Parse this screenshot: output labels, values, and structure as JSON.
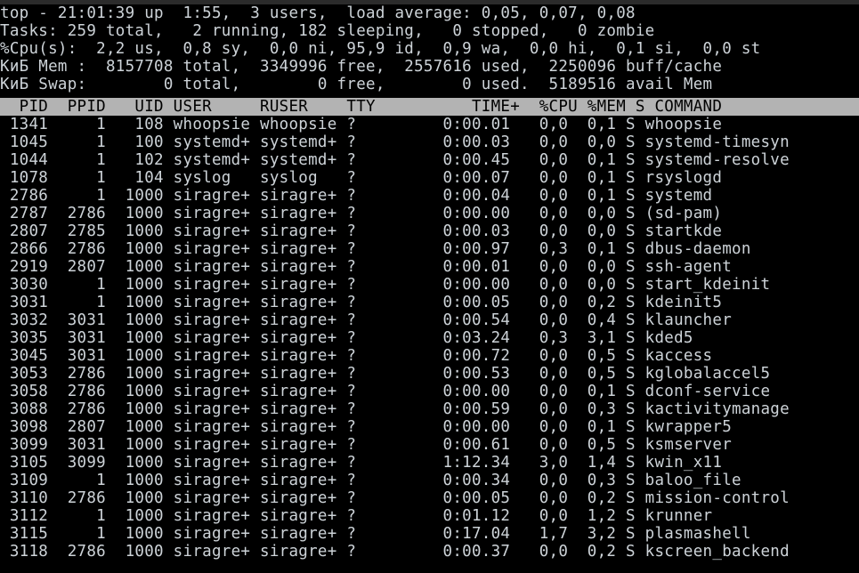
{
  "terminal": {
    "program": "top",
    "colors": {
      "background": "#000000",
      "foreground": "#cdd3d8",
      "header_background": "#b3b3b3",
      "header_foreground": "#000000",
      "title_strip": "#2b2b2b"
    }
  },
  "summary": {
    "uptime_line": "top - 21:01:39 up  1:55,  3 users,  load average: 0,05, 0,07, 0,08",
    "tasks_line": "Tasks: 259 total,   2 running, 182 sleeping,   0 stopped,   0 zombie",
    "cpu_line": "%Cpu(s):  2,2 us,  0,8 sy,  0,0 ni, 95,9 id,  0,9 wa,  0,0 hi,  0,1 si,  0,0 st",
    "mem_line": "КиБ Mem :  8157708 total,  3349996 free,  2557616 used,  2250096 buff/cache",
    "swap_line": "КиБ Swap:        0 total,        0 free,        0 used.  5189516 avail Mem",
    "fields": {
      "time": "21:01:39",
      "up": "1:55",
      "users": "3",
      "load_average": [
        "0,05",
        "0,07",
        "0,08"
      ],
      "tasks_total": "259",
      "tasks_running": "2",
      "tasks_sleeping": "182",
      "tasks_stopped": "0",
      "tasks_zombie": "0",
      "cpu_us": "2,2",
      "cpu_sy": "0,8",
      "cpu_ni": "0,0",
      "cpu_id": "95,9",
      "cpu_wa": "0,9",
      "cpu_hi": "0,0",
      "cpu_si": "0,1",
      "cpu_st": "0,0",
      "mem_unit": "КиБ",
      "mem_total": "8157708",
      "mem_free": "3349996",
      "mem_used": "2557616",
      "mem_buff_cache": "2250096",
      "swap_total": "0",
      "swap_free": "0",
      "swap_used": "0",
      "avail_mem": "5189516"
    }
  },
  "table": {
    "header_line": "  PID  PPID   UID USER     RUSER    TTY          TIME+  %CPU %MEM S COMMAND",
    "columns": [
      "PID",
      "PPID",
      "UID",
      "USER",
      "RUSER",
      "TTY",
      "TIME+",
      "%CPU",
      "%MEM",
      "S",
      "COMMAND"
    ],
    "rows": [
      " 1341     1   108 whoopsie whoopsie ?         0:00.01   0,0  0,1 S whoopsie",
      " 1045     1   100 systemd+ systemd+ ?         0:00.03   0,0  0,0 S systemd-timesyn",
      " 1044     1   102 systemd+ systemd+ ?         0:00.45   0,0  0,1 S systemd-resolve",
      " 1078     1   104 syslog   syslog   ?         0:00.07   0,0  0,1 S rsyslogd",
      " 2786     1  1000 siragre+ siragre+ ?         0:00.04   0,0  0,1 S systemd",
      " 2787  2786  1000 siragre+ siragre+ ?         0:00.00   0,0  0,0 S (sd-pam)",
      " 2807  2785  1000 siragre+ siragre+ ?         0:00.03   0,0  0,0 S startkde",
      " 2866  2786  1000 siragre+ siragre+ ?         0:00.97   0,3  0,1 S dbus-daemon",
      " 2919  2807  1000 siragre+ siragre+ ?         0:00.01   0,0  0,0 S ssh-agent",
      " 3030     1  1000 siragre+ siragre+ ?         0:00.00   0,0  0,0 S start_kdeinit",
      " 3031     1  1000 siragre+ siragre+ ?         0:00.05   0,0  0,2 S kdeinit5",
      " 3032  3031  1000 siragre+ siragre+ ?         0:00.54   0,0  0,4 S klauncher",
      " 3035  3031  1000 siragre+ siragre+ ?         0:03.24   0,3  3,1 S kded5",
      " 3045  3031  1000 siragre+ siragre+ ?         0:00.72   0,0  0,5 S kaccess",
      " 3053  2786  1000 siragre+ siragre+ ?         0:00.53   0,0  0,5 S kglobalaccel5",
      " 3058  2786  1000 siragre+ siragre+ ?         0:00.00   0,0  0,1 S dconf-service",
      " 3088  2786  1000 siragre+ siragre+ ?         0:00.59   0,0  0,3 S kactivitymanage",
      " 3098  2807  1000 siragre+ siragre+ ?         0:00.00   0,0  0,1 S kwrapper5",
      " 3099  3031  1000 siragre+ siragre+ ?         0:00.61   0,0  0,5 S ksmserver",
      " 3105  3099  1000 siragre+ siragre+ ?         1:12.34   3,0  1,4 S kwin_x11",
      " 3109     1  1000 siragre+ siragre+ ?         0:00.34   0,0  0,3 S baloo_file",
      " 3110  2786  1000 siragre+ siragre+ ?         0:00.05   0,0  0,2 S mission-control",
      " 3112     1  1000 siragre+ siragre+ ?         0:01.12   0,0  1,2 S krunner",
      " 3115     1  1000 siragre+ siragre+ ?         0:17.04   1,7  3,2 S plasmashell",
      " 3118  2786  1000 siragre+ siragre+ ?         0:00.37   0,0  0,2 S kscreen_backend"
    ],
    "row_records": [
      {
        "pid": "1341",
        "ppid": "1",
        "uid": "108",
        "user": "whoopsie",
        "ruser": "whoopsie",
        "tty": "?",
        "time": "0:00.01",
        "cpu": "0,0",
        "mem": "0,1",
        "s": "S",
        "command": "whoopsie"
      },
      {
        "pid": "1045",
        "ppid": "1",
        "uid": "100",
        "user": "systemd+",
        "ruser": "systemd+",
        "tty": "?",
        "time": "0:00.03",
        "cpu": "0,0",
        "mem": "0,0",
        "s": "S",
        "command": "systemd-timesyn"
      },
      {
        "pid": "1044",
        "ppid": "1",
        "uid": "102",
        "user": "systemd+",
        "ruser": "systemd+",
        "tty": "?",
        "time": "0:00.45",
        "cpu": "0,0",
        "mem": "0,1",
        "s": "S",
        "command": "systemd-resolve"
      },
      {
        "pid": "1078",
        "ppid": "1",
        "uid": "104",
        "user": "syslog",
        "ruser": "syslog",
        "tty": "?",
        "time": "0:00.07",
        "cpu": "0,0",
        "mem": "0,1",
        "s": "S",
        "command": "rsyslogd"
      },
      {
        "pid": "2786",
        "ppid": "1",
        "uid": "1000",
        "user": "siragre+",
        "ruser": "siragre+",
        "tty": "?",
        "time": "0:00.04",
        "cpu": "0,0",
        "mem": "0,1",
        "s": "S",
        "command": "systemd"
      },
      {
        "pid": "2787",
        "ppid": "2786",
        "uid": "1000",
        "user": "siragre+",
        "ruser": "siragre+",
        "tty": "?",
        "time": "0:00.00",
        "cpu": "0,0",
        "mem": "0,0",
        "s": "S",
        "command": "(sd-pam)"
      },
      {
        "pid": "2807",
        "ppid": "2785",
        "uid": "1000",
        "user": "siragre+",
        "ruser": "siragre+",
        "tty": "?",
        "time": "0:00.03",
        "cpu": "0,0",
        "mem": "0,0",
        "s": "S",
        "command": "startkde"
      },
      {
        "pid": "2866",
        "ppid": "2786",
        "uid": "1000",
        "user": "siragre+",
        "ruser": "siragre+",
        "tty": "?",
        "time": "0:00.97",
        "cpu": "0,3",
        "mem": "0,1",
        "s": "S",
        "command": "dbus-daemon"
      },
      {
        "pid": "2919",
        "ppid": "2807",
        "uid": "1000",
        "user": "siragre+",
        "ruser": "siragre+",
        "tty": "?",
        "time": "0:00.01",
        "cpu": "0,0",
        "mem": "0,0",
        "s": "S",
        "command": "ssh-agent"
      },
      {
        "pid": "3030",
        "ppid": "1",
        "uid": "1000",
        "user": "siragre+",
        "ruser": "siragre+",
        "tty": "?",
        "time": "0:00.00",
        "cpu": "0,0",
        "mem": "0,0",
        "s": "S",
        "command": "start_kdeinit"
      },
      {
        "pid": "3031",
        "ppid": "1",
        "uid": "1000",
        "user": "siragre+",
        "ruser": "siragre+",
        "tty": "?",
        "time": "0:00.05",
        "cpu": "0,0",
        "mem": "0,2",
        "s": "S",
        "command": "kdeinit5"
      },
      {
        "pid": "3032",
        "ppid": "3031",
        "uid": "1000",
        "user": "siragre+",
        "ruser": "siragre+",
        "tty": "?",
        "time": "0:00.54",
        "cpu": "0,0",
        "mem": "0,4",
        "s": "S",
        "command": "klauncher"
      },
      {
        "pid": "3035",
        "ppid": "3031",
        "uid": "1000",
        "user": "siragre+",
        "ruser": "siragre+",
        "tty": "?",
        "time": "0:03.24",
        "cpu": "0,3",
        "mem": "3,1",
        "s": "S",
        "command": "kded5"
      },
      {
        "pid": "3045",
        "ppid": "3031",
        "uid": "1000",
        "user": "siragre+",
        "ruser": "siragre+",
        "tty": "?",
        "time": "0:00.72",
        "cpu": "0,0",
        "mem": "0,5",
        "s": "S",
        "command": "kaccess"
      },
      {
        "pid": "3053",
        "ppid": "2786",
        "uid": "1000",
        "user": "siragre+",
        "ruser": "siragre+",
        "tty": "?",
        "time": "0:00.53",
        "cpu": "0,0",
        "mem": "0,5",
        "s": "S",
        "command": "kglobalaccel5"
      },
      {
        "pid": "3058",
        "ppid": "2786",
        "uid": "1000",
        "user": "siragre+",
        "ruser": "siragre+",
        "tty": "?",
        "time": "0:00.00",
        "cpu": "0,0",
        "mem": "0,1",
        "s": "S",
        "command": "dconf-service"
      },
      {
        "pid": "3088",
        "ppid": "2786",
        "uid": "1000",
        "user": "siragre+",
        "ruser": "siragre+",
        "tty": "?",
        "time": "0:00.59",
        "cpu": "0,0",
        "mem": "0,3",
        "s": "S",
        "command": "kactivitymanage"
      },
      {
        "pid": "3098",
        "ppid": "2807",
        "uid": "1000",
        "user": "siragre+",
        "ruser": "siragre+",
        "tty": "?",
        "time": "0:00.00",
        "cpu": "0,0",
        "mem": "0,1",
        "s": "S",
        "command": "kwrapper5"
      },
      {
        "pid": "3099",
        "ppid": "3031",
        "uid": "1000",
        "user": "siragre+",
        "ruser": "siragre+",
        "tty": "?",
        "time": "0:00.61",
        "cpu": "0,0",
        "mem": "0,5",
        "s": "S",
        "command": "ksmserver"
      },
      {
        "pid": "3105",
        "ppid": "3099",
        "uid": "1000",
        "user": "siragre+",
        "ruser": "siragre+",
        "tty": "?",
        "time": "1:12.34",
        "cpu": "3,0",
        "mem": "1,4",
        "s": "S",
        "command": "kwin_x11"
      },
      {
        "pid": "3109",
        "ppid": "1",
        "uid": "1000",
        "user": "siragre+",
        "ruser": "siragre+",
        "tty": "?",
        "time": "0:00.34",
        "cpu": "0,0",
        "mem": "0,3",
        "s": "S",
        "command": "baloo_file"
      },
      {
        "pid": "3110",
        "ppid": "2786",
        "uid": "1000",
        "user": "siragre+",
        "ruser": "siragre+",
        "tty": "?",
        "time": "0:00.05",
        "cpu": "0,0",
        "mem": "0,2",
        "s": "S",
        "command": "mission-control"
      },
      {
        "pid": "3112",
        "ppid": "1",
        "uid": "1000",
        "user": "siragre+",
        "ruser": "siragre+",
        "tty": "?",
        "time": "0:01.12",
        "cpu": "0,0",
        "mem": "1,2",
        "s": "S",
        "command": "krunner"
      },
      {
        "pid": "3115",
        "ppid": "1",
        "uid": "1000",
        "user": "siragre+",
        "ruser": "siragre+",
        "tty": "?",
        "time": "0:17.04",
        "cpu": "1,7",
        "mem": "3,2",
        "s": "S",
        "command": "plasmashell"
      },
      {
        "pid": "3118",
        "ppid": "2786",
        "uid": "1000",
        "user": "siragre+",
        "ruser": "siragre+",
        "tty": "?",
        "time": "0:00.37",
        "cpu": "0,0",
        "mem": "0,2",
        "s": "S",
        "command": "kscreen_backend"
      }
    ]
  }
}
